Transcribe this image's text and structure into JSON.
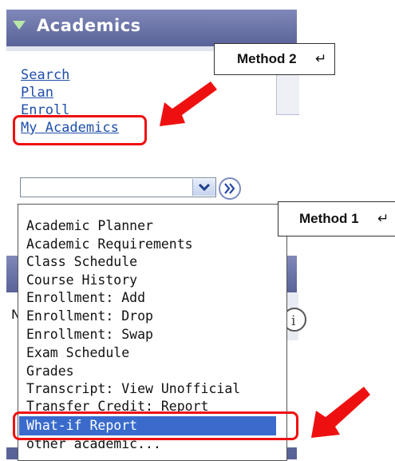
{
  "header": {
    "title": "Academics"
  },
  "links": [
    "Search",
    "Plan",
    "Enroll",
    "My Academics"
  ],
  "callouts": {
    "method2": "Method 2",
    "method1": "Method 1",
    "return_mark": "↵"
  },
  "dropdown": {
    "selected_value": "",
    "options": [
      "Academic Planner",
      "Academic Requirements",
      "Class Schedule",
      "Course History",
      "Enrollment: Add",
      "Enrollment: Drop",
      "Enrollment: Swap",
      "Exam Schedule",
      "Grades",
      "Transcript: View Unofficial",
      "Transfer Credit: Report",
      "What-if Report",
      "other academic..."
    ],
    "highlighted": "What-if Report"
  },
  "partial_text": {
    "left_letter": "N"
  },
  "colors": {
    "header": "#6a73a8",
    "link": "#1f4fa8",
    "highlight": "#3a6bcc",
    "annotation_red": "#ee1010"
  }
}
